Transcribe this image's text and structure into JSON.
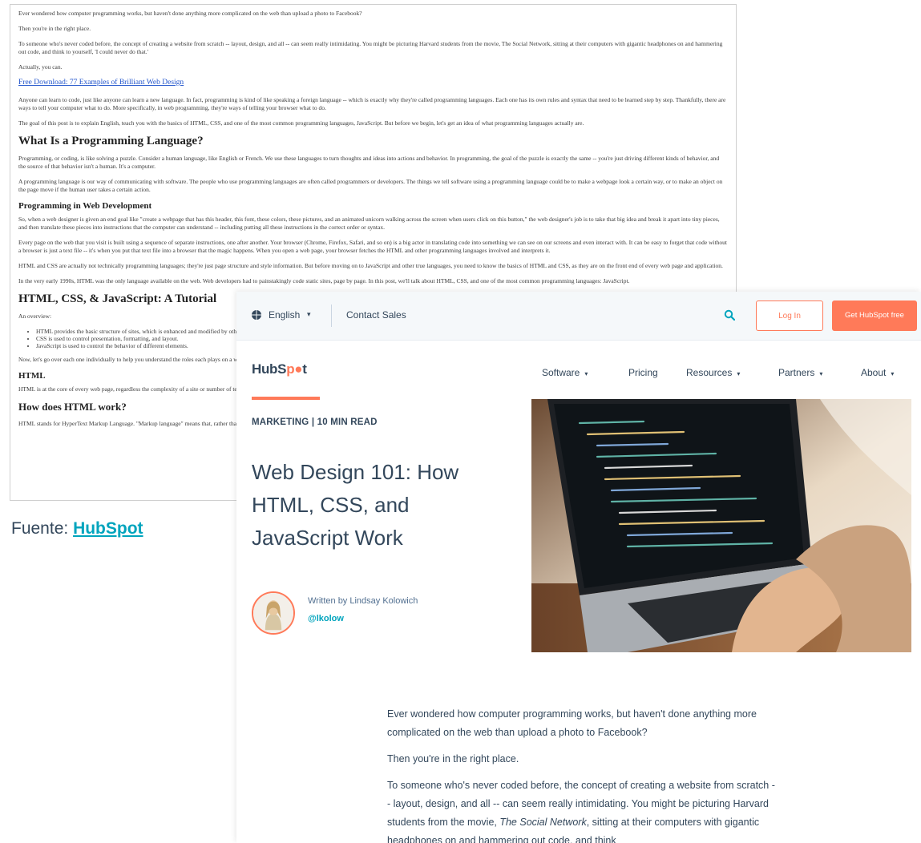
{
  "plain_page": {
    "p1": "Ever wondered how computer programming works, but haven't done anything more complicated on the web than upload a photo to Facebook?",
    "p2": "Then you're in the right place.",
    "p3": "To someone who's never coded before, the concept of creating a website from scratch -- layout, design, and all -- can seem really intimidating. You might be picturing Harvard students from the movie, The Social Network, sitting at their computers with gigantic headphones on and hammering out code, and think to yourself, 'I could never do that.'",
    "p4": "Actually, you can.",
    "link": "Free Download: 77 Examples of Brilliant Web Design",
    "p5": "Anyone can learn to code, just like anyone can learn a new language. In fact, programming is kind of like speaking a foreign language -- which is exactly why they're called programming languages. Each one has its own rules and syntax that need to be learned step by step. Thankfully, there are ways to tell your computer what to do. More specifically, in web programming, they're ways of telling your browser what to do.",
    "p6": "The goal of this post is to explain English, teach you with the basics of HTML, CSS, and one of the most common programming languages, JavaScript. But before we begin, let's get an idea of what programming languages actually are.",
    "h_what": "What Is a Programming Language?",
    "p7": "Programming, or coding, is like solving a puzzle. Consider a human language, like English or French. We use these languages to turn thoughts and ideas into actions and behavior. In programming, the goal of the puzzle is exactly the same -- you're just driving different kinds of behavior, and the source of that behavior isn't a human. It's a computer.",
    "p8": "A programming language is our way of communicating with software. The people who use programming languages are often called programmers or developers. The things we tell software using a programming language could be to make a webpage look a certain way, or to make an object on the page move if the human user takes a certain action.",
    "h_web": "Programming in Web Development",
    "p9": "So, when a web designer is given an end goal like \"create a webpage that has this header, this font, these colors, these pictures, and an animated unicorn walking across the screen when users click on this button,\" the web designer's job is to take that big idea and break it apart into tiny pieces, and then translate these pieces into instructions that the computer can understand -- including putting all these instructions in the correct order or syntax.",
    "p10": "Every page on the web that you visit is built using a sequence of separate instructions, one after another. Your browser (Chrome, Firefox, Safari, and so on) is a big actor in translating code into something we can see on our screens and even interact with. It can be easy to forget that code without a browser is just a text file -- it's when you put that text file into a browser that the magic happens. When you open a web page, your browser fetches the HTML and other programming languages involved and interprets it.",
    "p11": "HTML and CSS are actually not technically programming languages; they're just page structure and style information. But before moving on to JavaScript and other true languages, you need to know the basics of HTML and CSS, as they are on the front end of every web page and application.",
    "p12": "In the very early 1990s, HTML was the only language available on the web. Web developers had to painstakingly code static sites, page by page. In this post, we'll talk about HTML, CSS, and one of the most common programming languages: JavaScript.",
    "h_tutorial": "HTML, CSS, & JavaScript: A Tutorial",
    "p13": "An overview:",
    "li1": "HTML provides the basic structure of sites, which is enhanced and modified by other technologies like CSS and JavaScript.",
    "li2": "CSS is used to control presentation, formatting, and layout.",
    "li3": "JavaScript is used to control the behavior of different elements.",
    "p14": "Now, let's go over each one individually to help you understand the roles each plays on a website and then we'll cover how they fit together.",
    "h_html": "HTML",
    "p15": "HTML is at the core of every web page, regardless the complexity of a site or number of technologies involved. It's an essential skill for any web professional. It's the starting point for anyone learning how to create content for the web. And, luckily for us, it's surprisingly easy to learn.",
    "h_how": "How does HTML work?",
    "p16": "HTML stands for HyperText Markup Language. \"Markup language\" means that, rather than using a programming language to perform functions, HTML uses tags to identify different types of content and the purposes they each serve to the webpage."
  },
  "caption": {
    "prefix": "Fuente: ",
    "link": "HubSpot"
  },
  "hubspot": {
    "utility": {
      "language": "English",
      "contact": "Contact Sales",
      "login": "Log In",
      "get_free": "Get HubSpot free"
    },
    "logo": {
      "part1": "HubS",
      "part2": "p",
      "part3": "t"
    },
    "nav": [
      {
        "label": "Software",
        "caret": "▾"
      },
      {
        "label": "Pricing",
        "caret": ""
      },
      {
        "label": "Resources",
        "caret": "▾"
      },
      {
        "label": "Partners",
        "caret": "▾"
      },
      {
        "label": "About",
        "caret": "▾"
      }
    ],
    "kicker": "MARKETING | 10 MIN READ",
    "title": "Web Design 101: How HTML, CSS, and JavaScript Work",
    "author_line": "Written by Lindsay Kolowich",
    "author_handle": "@lkolow",
    "body": {
      "p1": "Ever wondered how computer programming works, but haven't done anything more complicated on the web than upload a photo to Facebook?",
      "p2": "Then you're in the right place.",
      "p3_a": "To someone who's never coded before, the concept of creating a website from scratch -- layout, design, and all -- can seem really intimidating. You might be picturing Harvard students from the movie, ",
      "p3_italic": "The Social Network",
      "p3_b": ", sitting at their computers with gigantic headphones on and hammering out code, and think"
    }
  },
  "colors": {
    "brand_orange": "#ff7a59",
    "text_dark": "#33475b",
    "link_teal": "#00a4bd"
  }
}
